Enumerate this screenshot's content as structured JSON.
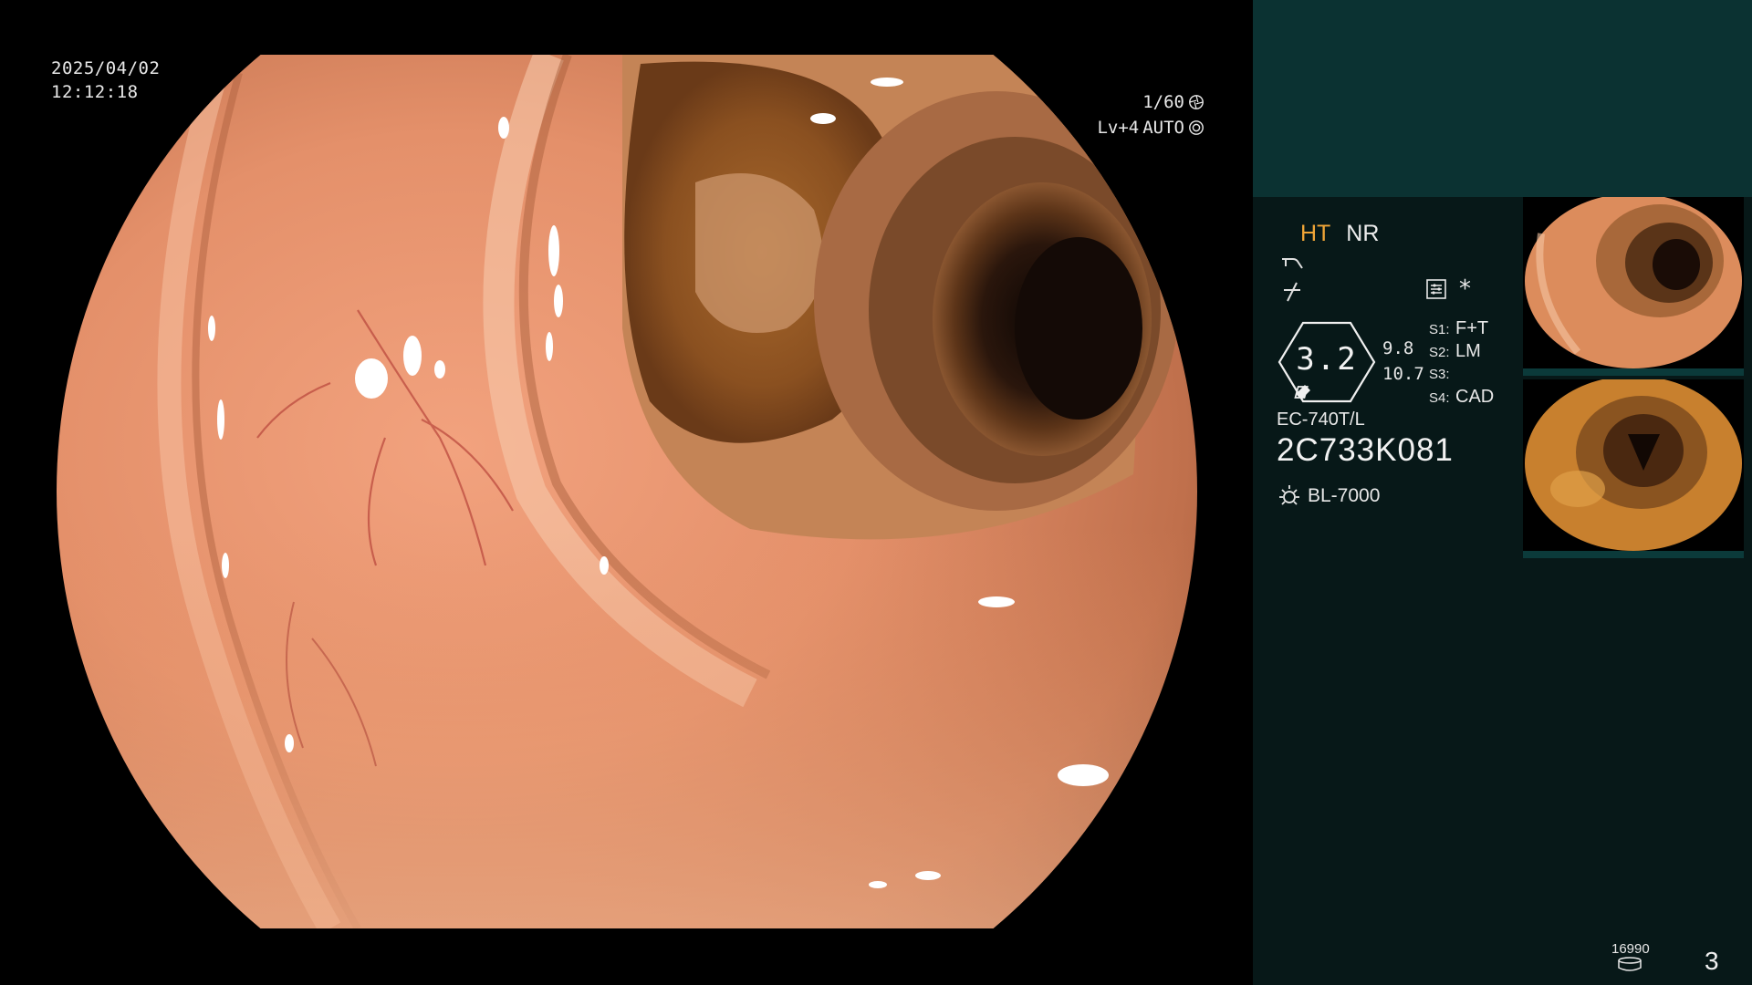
{
  "overlay": {
    "date": "2025/04/02",
    "time": "12:12:18",
    "shutter": "1/60",
    "level": "Lv+4",
    "iris_mode": "AUTO"
  },
  "panel": {
    "mode_ht": "HT",
    "mode_nr": "NR",
    "gauge_value": "3.2",
    "gauge_num_1": "9.8",
    "gauge_num_2": "10.7",
    "star": "*",
    "switches": [
      {
        "key": "S1:",
        "value": "F+T"
      },
      {
        "key": "S2:",
        "value": "LM"
      },
      {
        "key": "S3:",
        "value": ""
      },
      {
        "key": "S4:",
        "value": "CAD"
      }
    ],
    "scope_model": "EC-740T/L",
    "scope_serial": "2C733K081",
    "light_source": "BL-7000",
    "storage_count": "16990",
    "page_number": "3"
  },
  "colors": {
    "mode_ht": "#f0a537",
    "panel_top": "#0b3232",
    "panel_bg": "#071818"
  },
  "icons": [
    "shutter-icon",
    "iris-icon",
    "scope-symbol-icon",
    "freeze-symbol-icon",
    "settings-icon",
    "light-source-icon",
    "storage-icon"
  ]
}
